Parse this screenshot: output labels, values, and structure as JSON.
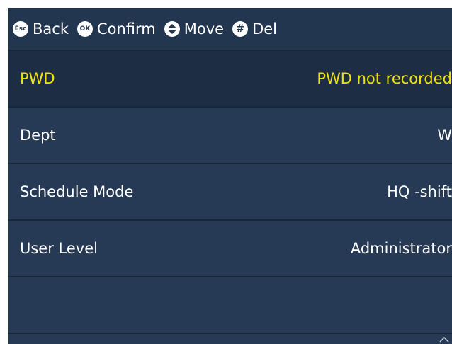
{
  "hint_bar": {
    "items": [
      {
        "key": "Esc",
        "label": "Back",
        "icon": "esc-key-icon"
      },
      {
        "key": "OK",
        "label": "Confirm",
        "icon": "ok-key-icon"
      },
      {
        "key": "",
        "label": "Move",
        "icon": "up-down-key-icon"
      },
      {
        "key": "#",
        "label": "Del",
        "icon": "hash-key-icon"
      }
    ]
  },
  "fields": [
    {
      "label": "PWD",
      "value": "PWD not recorded",
      "selected": true
    },
    {
      "label": "Dept",
      "value": "W",
      "selected": false
    },
    {
      "label": "Schedule Mode",
      "value": "HQ -shift",
      "selected": false
    },
    {
      "label": "User Level",
      "value": "Administrator",
      "selected": false
    }
  ],
  "colors": {
    "background": "#263a56",
    "selected_row": "#1d2e44",
    "selected_text": "#f2e20c",
    "text": "#ffffff",
    "divider": "#17273a"
  }
}
